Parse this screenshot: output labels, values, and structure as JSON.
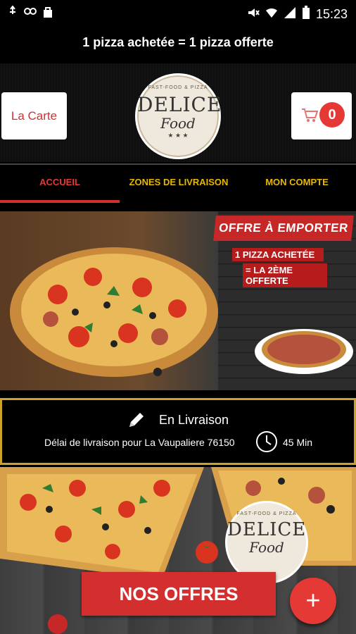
{
  "status_bar": {
    "time": "15:23",
    "left_icons": [
      "usb-icon",
      "link-icon",
      "shopping-bag-icon"
    ],
    "right_icons": [
      "mute-icon",
      "wifi-icon",
      "signal-icon",
      "battery-icon"
    ]
  },
  "marquee": {
    "text": "1 pizza achetée = 1 pizza offerte"
  },
  "header": {
    "carte_label": "La Carte",
    "cart_count": "0",
    "logo": {
      "tagline": "FAST-FOOD & PIZZA",
      "name": "DELICE",
      "sub": "Food",
      "stars": "★ ★ ★"
    }
  },
  "nav": {
    "tabs": [
      {
        "label": "ACCUEIL",
        "active": true
      },
      {
        "label": "ZONES DE LIVRAISON",
        "active": false
      },
      {
        "label": "MON COMPTE",
        "active": false
      }
    ]
  },
  "banner": {
    "offer_title": "OFFRE À EMPORTER",
    "offer_line1": "1 PIZZA ACHETÉE",
    "offer_line2": "= LA 2ÈME OFFERTE"
  },
  "delivery": {
    "title": "En Livraison",
    "text": "Délai de livraison pour La Vaupaliere 76150",
    "time": "45 Min"
  },
  "lower": {
    "logo": {
      "tagline": "FAST-FOOD & PIZZA",
      "name": "DELICE",
      "sub": "Food"
    },
    "offers_button": "NOS OFFRES",
    "fab_label": "+"
  },
  "colors": {
    "accent_red": "#d32f2f",
    "gold": "#e6b800",
    "border_gold": "#c9a227"
  }
}
